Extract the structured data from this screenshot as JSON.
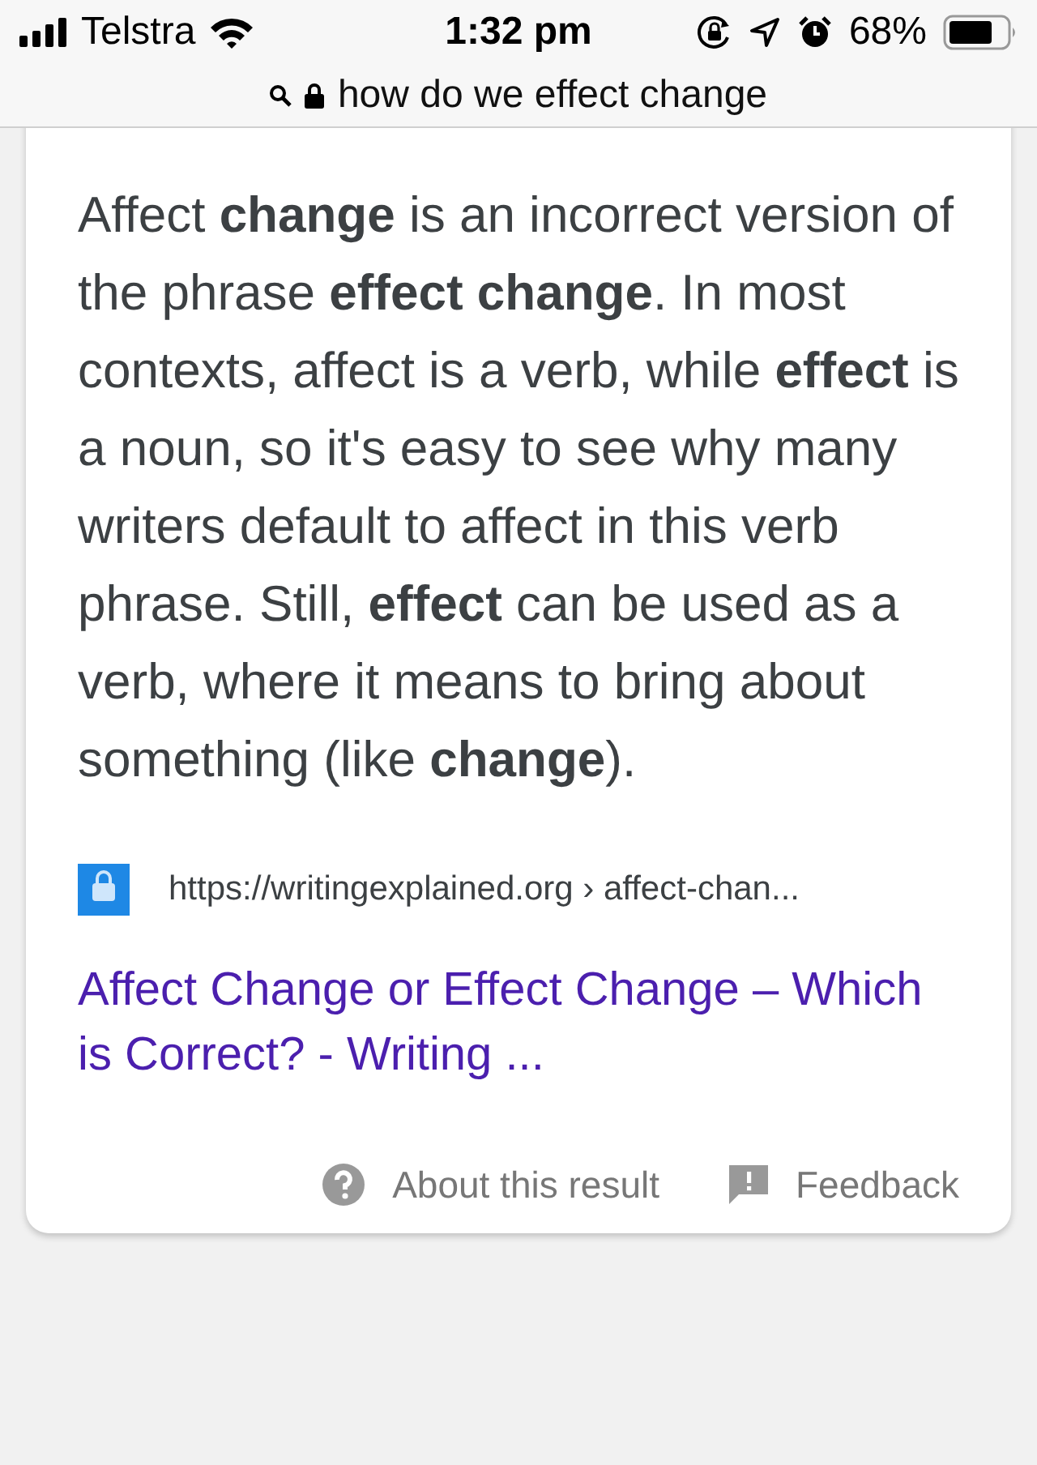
{
  "status_bar": {
    "carrier": "Telstra",
    "time": "1:32 pm",
    "battery": "68%"
  },
  "address_bar": {
    "query": "how do we effect change"
  },
  "result": {
    "snippet": "Affect **change** is an incorrect version of the phrase **effect change**. In most contexts, affect is a verb, while **effect** is a noun, so it's easy to see why many writers default to affect in this verb phrase. Still, **effect** can be used as a verb, where it means to bring about something (like **change**).",
    "url": "https://writingexplained.org › affect-chan...",
    "title": "Affect Change or Effect Change – Which is Correct? - Writing ...",
    "footer": [
      "About this result",
      "Feedback"
    ]
  }
}
